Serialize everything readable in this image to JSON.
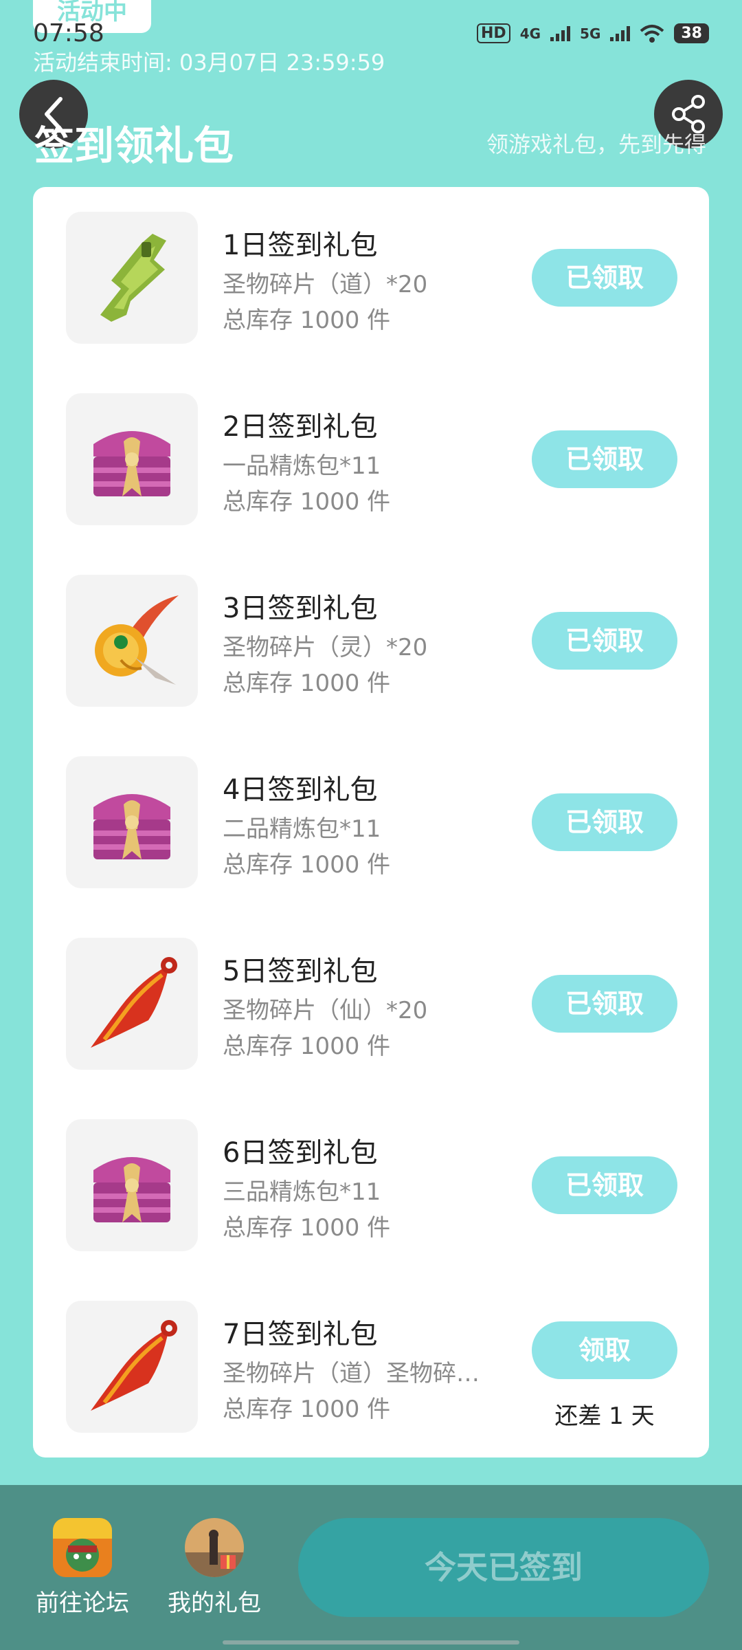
{
  "colors": {
    "background": "#86E3D9",
    "card": "#ffffff",
    "claim_button": "#8EE4E7",
    "bottom_bar": "#4E9087",
    "checkin_button": "#35A3A3"
  },
  "status_bar": {
    "time": "07:58",
    "activity_badge": "活动中",
    "hd": "HD",
    "signal_4g": "4G",
    "signal_5g": "5G",
    "battery": "38",
    "icons": [
      "wifi-icon",
      "signal-icon",
      "battery-icon"
    ]
  },
  "header": {
    "end_time": "活动结束时间: 03月07日 23:59:59",
    "title": "签到领礼包",
    "subtitle": "领游戏礼包，先到先得",
    "back_icon": "chevron-left-icon",
    "share_icon": "share-icon"
  },
  "gifts": [
    {
      "title": "1日签到礼包",
      "desc": "圣物碎片（道）*20",
      "stock": "总库存 1000 件",
      "button": "已领取",
      "icon": "jade-shard-icon"
    },
    {
      "title": "2日签到礼包",
      "desc": "一品精炼包*11",
      "stock": "总库存 1000 件",
      "button": "已领取",
      "icon": "treasure-chest-icon"
    },
    {
      "title": "3日签到礼包",
      "desc": "圣物碎片（灵）*20",
      "stock": "总库存 1000 件",
      "button": "已领取",
      "icon": "gold-ornament-icon"
    },
    {
      "title": "4日签到礼包",
      "desc": "二品精炼包*11",
      "stock": "总库存 1000 件",
      "button": "已领取",
      "icon": "treasure-chest-icon"
    },
    {
      "title": "5日签到礼包",
      "desc": "圣物碎片（仙）*20",
      "stock": "总库存 1000 件",
      "button": "已领取",
      "icon": "red-shard-icon"
    },
    {
      "title": "6日签到礼包",
      "desc": "三品精炼包*11",
      "stock": "总库存 1000 件",
      "button": "已领取",
      "icon": "treasure-chest-icon"
    },
    {
      "title": "7日签到礼包",
      "desc": "圣物碎片（道）圣物碎…",
      "stock": "总库存 1000 件",
      "button": "领取",
      "remain": "还差 1 天",
      "icon": "red-shard-icon"
    }
  ],
  "bottom": {
    "forum_label": "前往论坛",
    "gifts_label": "我的礼包",
    "checkin_label": "今天已签到"
  }
}
